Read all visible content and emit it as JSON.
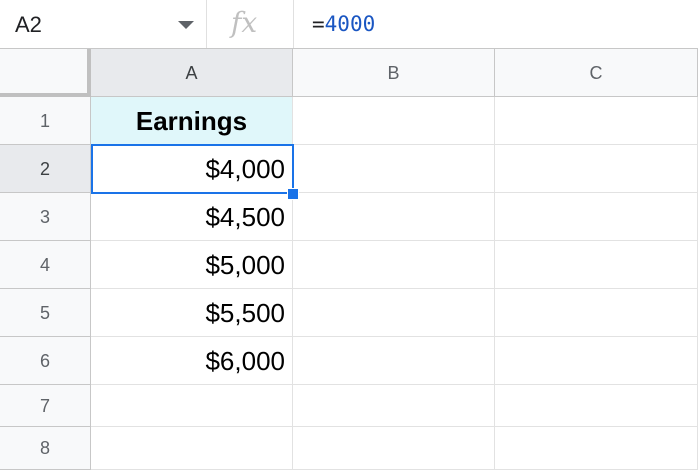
{
  "formula_bar": {
    "name_box": "A2",
    "fx_label": "fx",
    "formula_prefix": "=",
    "formula_value": "4000"
  },
  "columns": [
    "A",
    "B",
    "C"
  ],
  "rows": [
    "1",
    "2",
    "3",
    "4",
    "5",
    "6",
    "7",
    "8"
  ],
  "cells": {
    "A1": "Earnings",
    "A2": "$4,000",
    "A3": "$4,500",
    "A4": "$5,000",
    "A5": "$5,500",
    "A6": "$6,000"
  },
  "selected_cell": "A2",
  "colors": {
    "header_fill": "#e0f7fa",
    "selection": "#1a73e8",
    "formula_number": "#1a56c2"
  }
}
